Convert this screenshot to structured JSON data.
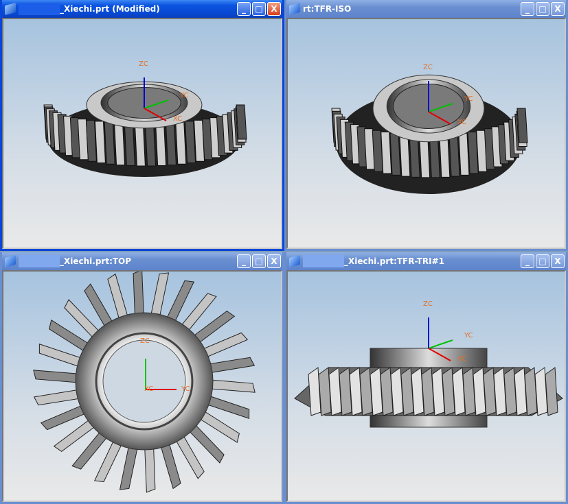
{
  "windows": [
    {
      "title": "_Xiechi.prt (Modified)",
      "active": true,
      "view": "trimetric"
    },
    {
      "title": "rt:TFR-ISO",
      "active": false,
      "view": "isometric"
    },
    {
      "title": "_Xiechi.prt:TOP",
      "active": false,
      "view": "top"
    },
    {
      "title": "_Xiechi.prt:TFR-TRI#1",
      "active": false,
      "view": "front"
    }
  ],
  "axes": {
    "z": "ZC",
    "y": "YC",
    "x": "XC"
  },
  "buttons": {
    "minimize": "_",
    "maximize": "□",
    "close": "X"
  },
  "colors": {
    "active_title": "#0a54e0",
    "inactive_title": "#6a8fd0",
    "axis_label": "#e0702a",
    "x_axis": "#e00000",
    "y_axis": "#00c000",
    "z_axis": "#0000d0"
  }
}
